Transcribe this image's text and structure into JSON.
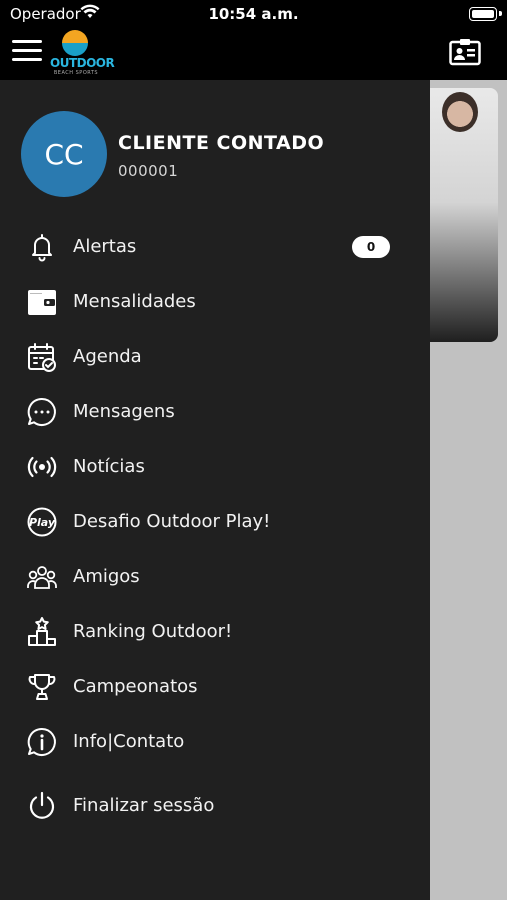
{
  "status_bar": {
    "carrier": "Operador",
    "time": "10:54 a.m."
  },
  "app_bar": {
    "logo_text": "OUTDOOR",
    "logo_subtitle": "BEACH SPORTS"
  },
  "profile": {
    "initials": "CC",
    "name": "CLIENTE CONTADO",
    "id": "000001"
  },
  "menu": {
    "items": [
      {
        "label": "Alertas",
        "icon": "bell-icon",
        "badge": "0"
      },
      {
        "label": "Mensalidades",
        "icon": "wallet-icon"
      },
      {
        "label": "Agenda",
        "icon": "calendar-check-icon"
      },
      {
        "label": "Mensagens",
        "icon": "chat-bubble-icon"
      },
      {
        "label": "Notícias",
        "icon": "broadcast-icon"
      },
      {
        "label": "Desafio Outdoor Play!",
        "icon": "play-badge-icon"
      },
      {
        "label": "Amigos",
        "icon": "people-icon"
      },
      {
        "label": "Ranking Outdoor!",
        "icon": "podium-icon"
      },
      {
        "label": "Campeonatos",
        "icon": "trophy-icon"
      },
      {
        "label": "Info|Contato",
        "icon": "info-icon"
      },
      {
        "label": "Finalizar sessão",
        "icon": "power-icon"
      }
    ]
  },
  "colors": {
    "drawer_bg": "#202020",
    "avatar_bg": "#2a7ab0",
    "logo_blue": "#2ab6e0",
    "logo_orange": "#f3a521"
  }
}
